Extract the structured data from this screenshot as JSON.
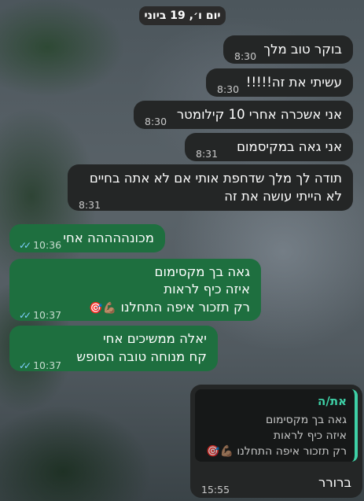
{
  "date_label": "יום ו׳, 19 ביוני",
  "messages": [
    {
      "text": "בוקר טוב מלך",
      "time": "8:30"
    },
    {
      "text": "עשיתי את זה!!!!!",
      "time": "8:30"
    },
    {
      "text": "אני אשכרה אחרי 10 קילומטר",
      "time": "8:30"
    },
    {
      "text": "אני גאה במקיסמום",
      "time": "8:31"
    },
    {
      "line1": "תודה לך מלך שדחפת אותי אם לא אתה בחיים",
      "line2": "לא הייתי עושה את זה",
      "time": "8:31"
    },
    {
      "text": "מכונההההה אחי",
      "time": "10:36"
    },
    {
      "line1": "גאה בך מקסימום",
      "line2": "איזה כיף לראות",
      "line3": "רק תזכור איפה התחלנו",
      "time": "10:37"
    },
    {
      "line1": "יאלה ממשיכים אחי",
      "line2": "קח מנוחה טובה הסופש",
      "time": "10:37"
    },
    {
      "quote_name": "את/ה",
      "quote_line1": "גאה בך מקסימום",
      "quote_line2": "איזה כיף לראות",
      "quote_line3": "רק תזכור איפה התחלנו",
      "text": "ברורר",
      "time": "15:55"
    }
  ],
  "icons": {
    "read_receipt": "double-check-icon",
    "emoji_1": "flexed-biceps-emoji",
    "emoji_2": "target-emoji"
  },
  "colors": {
    "incoming": "#242626",
    "outgoing": "#1e6f3f",
    "quote_accent": "#3ed0a6",
    "read_tick": "#7fd0ff"
  }
}
